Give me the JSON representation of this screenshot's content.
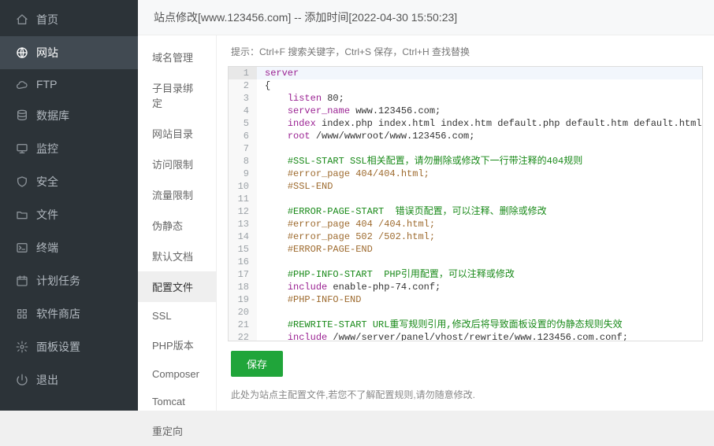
{
  "sidebar": {
    "items": [
      {
        "key": "home",
        "label": "首页",
        "icon": "home-icon"
      },
      {
        "key": "site",
        "label": "网站",
        "icon": "globe-icon",
        "active": true
      },
      {
        "key": "ftp",
        "label": "FTP",
        "icon": "cloud-icon"
      },
      {
        "key": "db",
        "label": "数据库",
        "icon": "database-icon"
      },
      {
        "key": "monitor",
        "label": "监控",
        "icon": "monitor-icon"
      },
      {
        "key": "safe",
        "label": "安全",
        "icon": "shield-icon"
      },
      {
        "key": "files",
        "label": "文件",
        "icon": "folder-icon"
      },
      {
        "key": "term",
        "label": "终端",
        "icon": "terminal-icon"
      },
      {
        "key": "cron",
        "label": "计划任务",
        "icon": "schedule-icon"
      },
      {
        "key": "store",
        "label": "软件商店",
        "icon": "grid-icon"
      },
      {
        "key": "panel",
        "label": "面板设置",
        "icon": "gear-icon"
      },
      {
        "key": "logout",
        "label": "退出",
        "icon": "power-icon"
      }
    ]
  },
  "header": {
    "title": "站点修改[www.123456.com] -- 添加时间[2022-04-30 15:50:23]"
  },
  "tabs": [
    {
      "key": "domain",
      "label": "域名管理"
    },
    {
      "key": "subdir",
      "label": "子目录绑定"
    },
    {
      "key": "sitedir",
      "label": "网站目录"
    },
    {
      "key": "access",
      "label": "访问限制"
    },
    {
      "key": "traffic",
      "label": "流量限制"
    },
    {
      "key": "rewrite",
      "label": "伪静态"
    },
    {
      "key": "defdoc",
      "label": "默认文档"
    },
    {
      "key": "config",
      "label": "配置文件",
      "active": true
    },
    {
      "key": "ssl",
      "label": "SSL"
    },
    {
      "key": "php",
      "label": "PHP版本"
    },
    {
      "key": "composer",
      "label": "Composer"
    },
    {
      "key": "tomcat",
      "label": "Tomcat"
    },
    {
      "key": "redirect",
      "label": "重定向"
    }
  ],
  "hint": "提示：Ctrl+F 搜索关键字，Ctrl+S 保存，Ctrl+H 查找替换",
  "editor": {
    "active_line": 1,
    "lines": [
      {
        "n": 1,
        "tokens": [
          [
            "kw",
            "server"
          ]
        ]
      },
      {
        "n": 2,
        "tokens": [
          [
            "",
            "{"
          ]
        ]
      },
      {
        "n": 3,
        "tokens": [
          [
            "",
            "    "
          ],
          [
            "kw",
            "listen"
          ],
          [
            "",
            " 80;"
          ]
        ]
      },
      {
        "n": 4,
        "tokens": [
          [
            "",
            "    "
          ],
          [
            "kw",
            "server_name"
          ],
          [
            "",
            " www.123456.com;"
          ]
        ]
      },
      {
        "n": 5,
        "tokens": [
          [
            "",
            "    "
          ],
          [
            "kw",
            "index"
          ],
          [
            "",
            " index.php index.html index.htm default.php default.htm default.html;"
          ]
        ]
      },
      {
        "n": 6,
        "tokens": [
          [
            "",
            "    "
          ],
          [
            "kw",
            "root"
          ],
          [
            "",
            " /www/wwwroot/www.123456.com;"
          ]
        ]
      },
      {
        "n": 7,
        "tokens": [
          [
            "",
            ""
          ]
        ]
      },
      {
        "n": 8,
        "tokens": [
          [
            "",
            "    "
          ],
          [
            "cm",
            "#SSL-START SSL相关配置，请勿删除或修改下一行带注释的404规则"
          ]
        ]
      },
      {
        "n": 9,
        "tokens": [
          [
            "",
            "    "
          ],
          [
            "cm2",
            "#error_page 404/404.html;"
          ]
        ]
      },
      {
        "n": 10,
        "tokens": [
          [
            "",
            "    "
          ],
          [
            "cm2",
            "#SSL-END"
          ]
        ]
      },
      {
        "n": 11,
        "tokens": [
          [
            "",
            ""
          ]
        ]
      },
      {
        "n": 12,
        "tokens": [
          [
            "",
            "    "
          ],
          [
            "cm",
            "#ERROR-PAGE-START  错误页配置，可以注释、删除或修改"
          ]
        ]
      },
      {
        "n": 13,
        "tokens": [
          [
            "",
            "    "
          ],
          [
            "cm2",
            "#error_page 404 /404.html;"
          ]
        ]
      },
      {
        "n": 14,
        "tokens": [
          [
            "",
            "    "
          ],
          [
            "cm2",
            "#error_page 502 /502.html;"
          ]
        ]
      },
      {
        "n": 15,
        "tokens": [
          [
            "",
            "    "
          ],
          [
            "cm2",
            "#ERROR-PAGE-END"
          ]
        ]
      },
      {
        "n": 16,
        "tokens": [
          [
            "",
            ""
          ]
        ]
      },
      {
        "n": 17,
        "tokens": [
          [
            "",
            "    "
          ],
          [
            "cm",
            "#PHP-INFO-START  PHP引用配置，可以注释或修改"
          ]
        ]
      },
      {
        "n": 18,
        "tokens": [
          [
            "",
            "    "
          ],
          [
            "kw",
            "include"
          ],
          [
            "",
            " enable-php-74.conf;"
          ]
        ]
      },
      {
        "n": 19,
        "tokens": [
          [
            "",
            "    "
          ],
          [
            "cm2",
            "#PHP-INFO-END"
          ]
        ]
      },
      {
        "n": 20,
        "tokens": [
          [
            "",
            ""
          ]
        ]
      },
      {
        "n": 21,
        "tokens": [
          [
            "",
            "    "
          ],
          [
            "cm",
            "#REWRITE-START URL重写规则引用,修改后将导致面板设置的伪静态规则失效"
          ]
        ]
      },
      {
        "n": 22,
        "tokens": [
          [
            "",
            "    "
          ],
          [
            "kw",
            "include"
          ],
          [
            "",
            " /www/server/panel/vhost/rewrite/www.123456.com.conf;"
          ]
        ]
      }
    ]
  },
  "footer": {
    "save": "保存",
    "note": "此处为站点主配置文件,若您不了解配置规则,请勿随意修改."
  },
  "colors": {
    "sidebar_bg": "#2c3338",
    "sidebar_active": "#414a52",
    "accent_green": "#20a53a",
    "comment_green": "#1a8a1a",
    "keyword_purple": "#9b2393"
  }
}
